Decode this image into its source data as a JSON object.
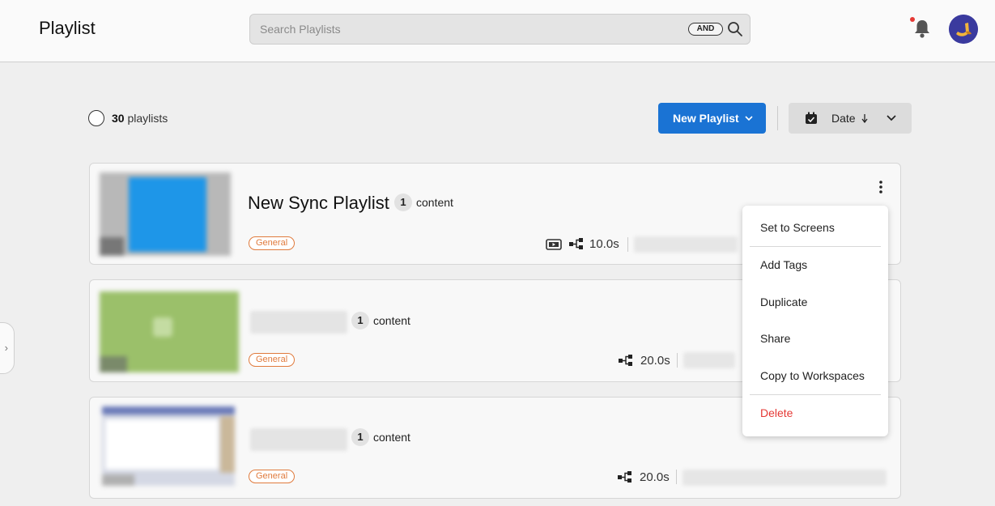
{
  "header": {
    "title": "Playlist",
    "search_placeholder": "Search Playlists",
    "search_mode": "AND",
    "notification_icon": "bell-icon",
    "has_unread": true
  },
  "toolbar": {
    "count": "30",
    "count_suffix": "playlists",
    "new_button": "New Playlist",
    "sort_label": "Date",
    "sort_direction": "descending"
  },
  "playlists": [
    {
      "title": "New Sync Playlist",
      "content_count": "1",
      "content_label": "content",
      "tag": "General",
      "duration": "10.0s"
    },
    {
      "title": "",
      "content_count": "1",
      "content_label": "content",
      "tag": "General",
      "duration": "20.0s"
    },
    {
      "title": "",
      "content_count": "1",
      "content_label": "content",
      "tag": "General",
      "duration": "20.0s"
    }
  ],
  "context_menu": {
    "items": [
      "Set to Screens",
      "Add Tags",
      "Duplicate",
      "Share",
      "Copy to Workspaces",
      "Delete"
    ]
  },
  "colors": {
    "primary": "#1a73d4",
    "tag": "#e07a3c",
    "danger": "#e53935"
  }
}
